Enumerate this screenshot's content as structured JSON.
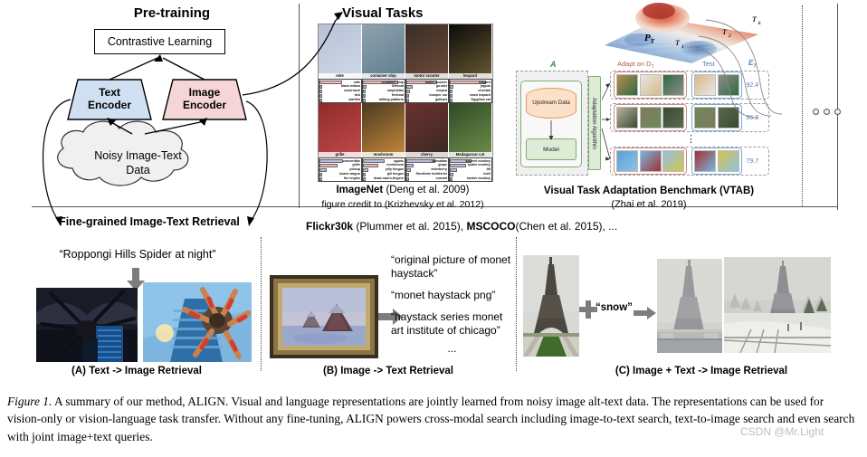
{
  "pretraining": {
    "title": "Pre-training",
    "contrastive_box": "Contrastive Learning",
    "text_encoder": {
      "line1": "Text",
      "line2": "Encoder",
      "color": "#cfe0f2"
    },
    "image_encoder": {
      "line1": "Image",
      "line2": "Encoder",
      "color": "#f6d5d6"
    },
    "cloud": {
      "line1": "Noisy Image-Text",
      "line2": "Data"
    },
    "fine_grained_label": "Fine-grained Image-Text Retrieval"
  },
  "visual_tasks": {
    "title": "Visual Tasks",
    "imagenet": {
      "caption_main": "ImageNet",
      "caption_cite": "(Deng et al. 2009)",
      "caption_sub": "figure credit to (Krizhevsky et al. 2012)",
      "cells": [
        {
          "label": "mite",
          "predictions": [
            "mite",
            "black widow",
            "cockroach",
            "tick",
            "starfish"
          ],
          "bars": [
            60,
            8,
            6,
            4,
            3
          ],
          "highlight": 0
        },
        {
          "label": "container ship",
          "predictions": [
            "container ship",
            "lifeboat",
            "amphibian",
            "fireboat",
            "drilling platform"
          ],
          "bars": [
            92,
            10,
            6,
            4,
            3
          ],
          "highlight": 0
        },
        {
          "label": "motor scooter",
          "predictions": [
            "motor scooter",
            "go-kart",
            "moped",
            "bumper car",
            "golfcart"
          ],
          "bars": [
            80,
            16,
            10,
            6,
            4
          ],
          "highlight": 0
        },
        {
          "label": "leopard",
          "predictions": [
            "leopard",
            "jaguar",
            "cheetah",
            "snow leopard",
            "Egyptian cat"
          ],
          "bars": [
            96,
            9,
            6,
            4,
            3
          ],
          "highlight": 0
        },
        {
          "label": "grille",
          "predictions": [
            "convertible",
            "grille",
            "pickup",
            "beach wagon",
            "fire engine"
          ],
          "bars": [
            62,
            48,
            18,
            5,
            4
          ],
          "highlight": 1
        },
        {
          "label": "mushroom",
          "predictions": [
            "agaric",
            "mushroom",
            "jelly fungus",
            "gill fungus",
            "dead-man's-fingers"
          ],
          "bars": [
            58,
            40,
            14,
            8,
            4
          ],
          "highlight": 1
        },
        {
          "label": "cherry",
          "predictions": [
            "dalmatian",
            "grape",
            "elderberry",
            "ffordshire bullterrier",
            "currant"
          ],
          "bars": [
            75,
            20,
            12,
            7,
            5
          ],
          "highlight": -1
        },
        {
          "label": "Madagascar cat",
          "predictions": [
            "squirrel monkey",
            "spider monkey",
            "titi",
            "indri",
            "howler monkey"
          ],
          "bars": [
            58,
            44,
            20,
            10,
            6
          ],
          "highlight": -1
        }
      ]
    },
    "vtab": {
      "caption_main": "Visual Task Adaptation Benchmark (VTAB)",
      "caption_sub": "(Zhai et al. 2019)",
      "surface_label": "P",
      "surface_label_sub": "T",
      "task_labels": [
        "T",
        "T",
        "T"
      ],
      "task_label_subs": [
        "1",
        "2",
        "k"
      ],
      "adapt_label": "Adapt on D",
      "adapt_label_sub": "T",
      "test_label": "Test",
      "metric_label": "E",
      "metric_label_sub": "T",
      "a_icon": "A",
      "upstream_data": "Upstream Data",
      "model": "Model",
      "adaptation_algorithm": "Adaptation Algorithm",
      "scores": [
        "92.4",
        "96.3",
        "79.7"
      ],
      "vdots": "⋮",
      "more_dots": "o o o"
    },
    "flickr_line": {
      "ds1": "Flickr30k",
      "cite1": "(Plummer et al. 2015),",
      "ds2": "MSCOCO",
      "cite2": "(Chen et al. 2015), ..."
    }
  },
  "panels": [
    {
      "id": "A",
      "caption": "(A) Text -> Image Retrieval",
      "query_text": "“Roppongi Hills Spider at night”"
    },
    {
      "id": "B",
      "caption": "(B) Image -> Text Retrieval",
      "results": [
        "“original picture of monet haystack”",
        "“monet haystack png”",
        "“haystack series monet art institute of chicago”",
        "..."
      ]
    },
    {
      "id": "C",
      "caption": "(C) Image + Text -> Image Retrieval",
      "modifier_text": "“snow”"
    }
  ],
  "figure_caption": {
    "number": "Figure 1.",
    "text": " A summary of our method, ALIGN. Visual and language representations are jointly learned from noisy image alt-text data. The representations can be used for vision-only or vision-language task transfer. Without any fine-tuning, ALIGN powers cross-modal search including image-to-text search, text-to-image search and even search with joint image+text queries."
  },
  "watermark": "CSDN @Mr.Light"
}
